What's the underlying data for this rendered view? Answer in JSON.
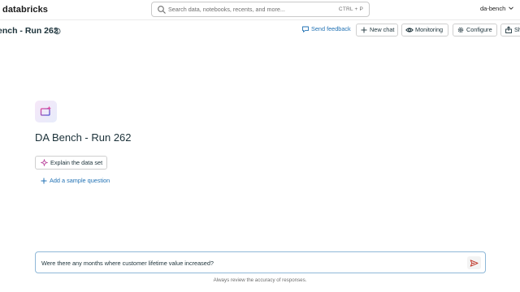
{
  "topbar": {
    "brand": "databricks",
    "search_placeholder": "Search data, notebooks, recents, and more...",
    "search_shortcut": "CTRL + P",
    "workspace": "da-bench"
  },
  "header": {
    "title": "ench - Run 262",
    "send_feedback": "Send feedback",
    "new_chat": "New chat",
    "monitoring": "Monitoring",
    "configure": "Configure",
    "share": "Sh"
  },
  "main": {
    "space_title": "DA Bench - Run 262",
    "explain_button": "Explain the data set",
    "add_sample_question": "Add a sample question"
  },
  "chat": {
    "input_value": "Were there any months where customer lifetime value increased?",
    "disclaimer": "Always review the accuracy of responses."
  },
  "colors": {
    "link": "#2272b4",
    "send_icon": "#c0392b",
    "input_border": "#8fb8d8"
  },
  "icons": {
    "search": "search-icon",
    "history": "history-icon",
    "feedback": "speech-bubble-icon",
    "new_chat": "plus-icon",
    "monitoring": "eye-icon",
    "configure": "gear-icon",
    "share": "share-icon",
    "space_logo": "sparkle-screen-icon",
    "explain": "sparkle-icon",
    "add": "plus-icon",
    "send": "send-icon"
  }
}
